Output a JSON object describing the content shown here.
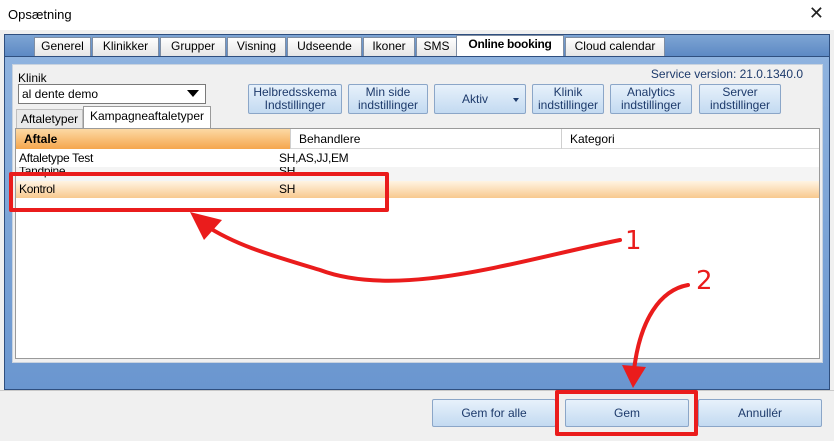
{
  "window": {
    "title": "Opsætning",
    "close_glyph": "✕"
  },
  "tabs": [
    {
      "label": "Generel"
    },
    {
      "label": "Klinikker"
    },
    {
      "label": "Grupper"
    },
    {
      "label": "Visning"
    },
    {
      "label": "Udseende"
    },
    {
      "label": "Ikoner"
    },
    {
      "label": "SMS"
    },
    {
      "label": "Online booking",
      "active": true
    },
    {
      "label": "Cloud calendar"
    }
  ],
  "toolbar": {
    "klinik_label": "Klinik",
    "klinik_value": "al dente demo",
    "service_version": "Service version: 21.0.1340.0",
    "buttons": [
      {
        "line1": "Helbredsskema",
        "line2": "Indstillinger"
      },
      {
        "line1": "Min side",
        "line2": "indstillinger"
      },
      {
        "line1": "Aktiv",
        "line2": ""
      },
      {
        "line1": "Klinik",
        "line2": "indstillinger"
      },
      {
        "line1": "Analytics",
        "line2": "indstillinger"
      },
      {
        "line1": "Server",
        "line2": "indstillinger"
      }
    ]
  },
  "subtabs": [
    {
      "label": "Aftaletyper"
    },
    {
      "label": "Kampagneaftaletyper",
      "active": true
    }
  ],
  "grid": {
    "columns": [
      "Aftale",
      "Behandlere",
      "Kategori"
    ],
    "rows": [
      {
        "aftale": "Aftaletype Test",
        "behandlere": "SH,AS,JJ,EM",
        "kategori": ""
      },
      {
        "aftale": "Tandpine",
        "behandlere": "SH",
        "kategori": ""
      },
      {
        "aftale": "Kontrol",
        "behandlere": "SH",
        "kategori": "",
        "selected": true
      }
    ]
  },
  "annotations": {
    "label_1": "1",
    "label_2": "2",
    "color": "#ea1c1c"
  },
  "footer": {
    "save_all": "Gem for alle",
    "save": "Gem",
    "cancel": "Annullér"
  },
  "colors": {
    "accent_orange": "#f5a64d",
    "tab_blue": "#6a96cf",
    "button_text": "#1d3a6b"
  }
}
